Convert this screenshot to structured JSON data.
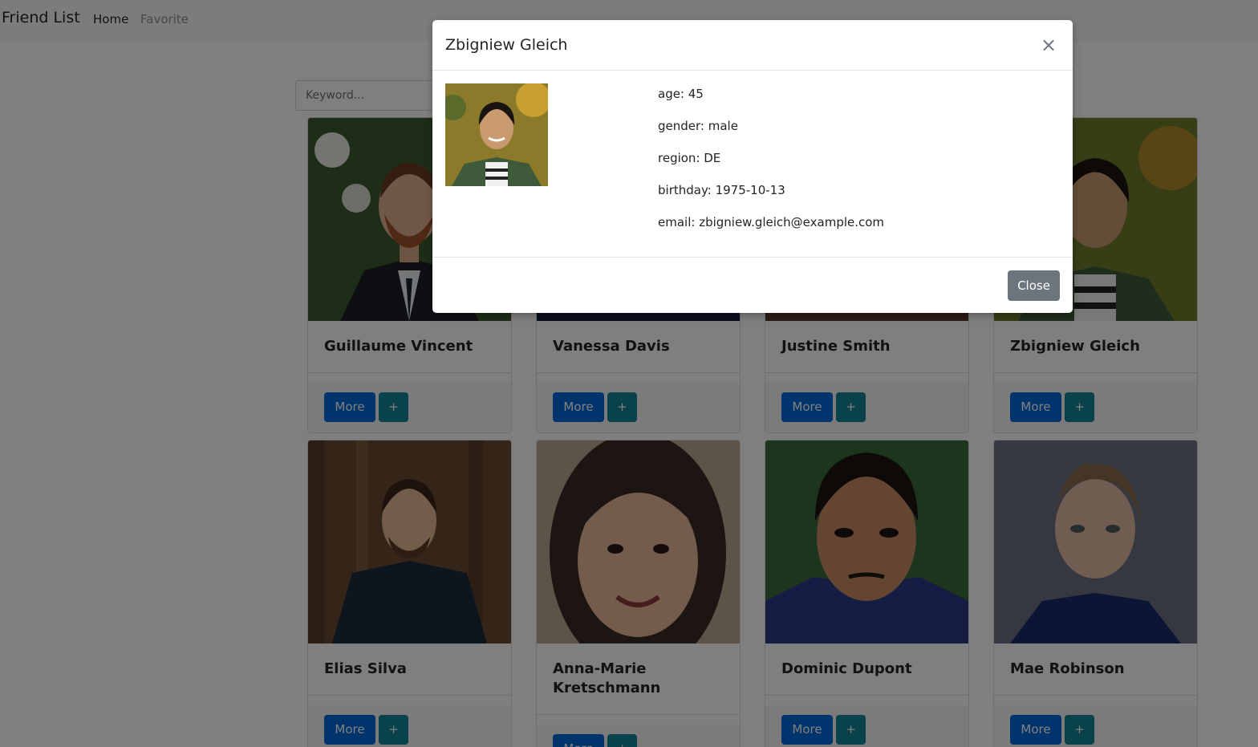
{
  "navbar": {
    "brand": "Friend List",
    "home": "Home",
    "favorite": "Favorite"
  },
  "search": {
    "placeholder": "Keyword..."
  },
  "cards": [
    {
      "name": "Guillaume Vincent",
      "more": "More",
      "add": "+"
    },
    {
      "name": "Vanessa Davis",
      "more": "More",
      "add": "+"
    },
    {
      "name": "Justine Smith",
      "more": "More",
      "add": "+"
    },
    {
      "name": "Zbigniew Gleich",
      "more": "More",
      "add": "+"
    },
    {
      "name": "Elias Silva",
      "more": "More",
      "add": "+"
    },
    {
      "name": "Anna-Marie Kretschmann",
      "more": "More",
      "add": "+"
    },
    {
      "name": "Dominic Dupont",
      "more": "More",
      "add": "+"
    },
    {
      "name": "Mae Robinson",
      "more": "More",
      "add": "+"
    }
  ],
  "modal": {
    "title": "Zbigniew Gleich",
    "close_x": "×",
    "age": "age: 45",
    "gender": "gender: male",
    "region": "region: DE",
    "birthday": "birthday: 1975-10-13",
    "email": "email: zbigniew.gleich@example.com",
    "close_button": "Close"
  }
}
